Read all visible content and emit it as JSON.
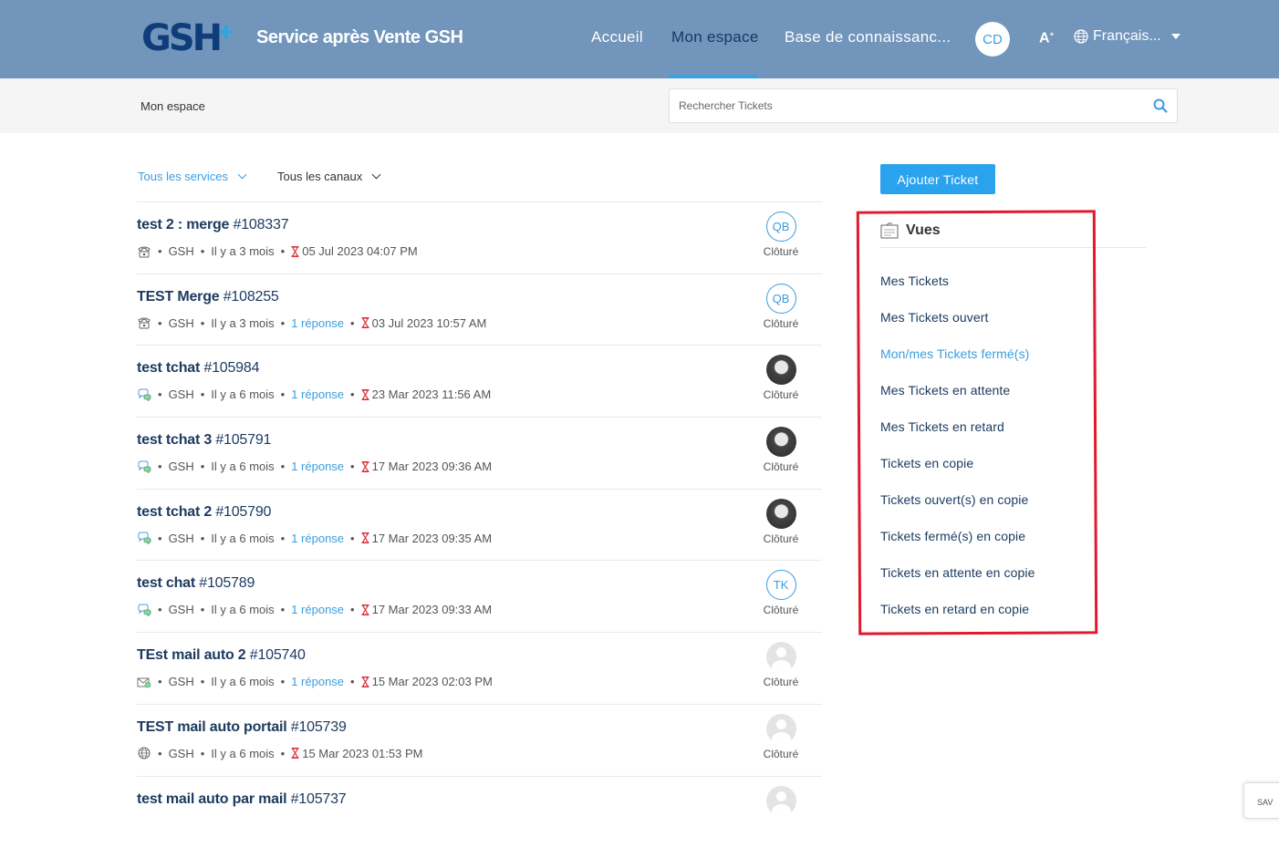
{
  "header": {
    "logo_text": "GSH",
    "logo_plus": "+",
    "title": "Service après Vente GSH",
    "nav": [
      {
        "label": "Accueil"
      },
      {
        "label": "Mon espace"
      },
      {
        "label": "Base de connaissanc..."
      }
    ],
    "avatar_initials": "CD",
    "font_size_glyph": "A",
    "language": "Français..."
  },
  "subbar": {
    "breadcrumb": "Mon espace",
    "search_placeholder": "Rechercher Tickets"
  },
  "filters": {
    "services": "Tous les services",
    "channels": "Tous les canaux"
  },
  "tickets": [
    {
      "title": "test 2 : merge",
      "number": "#108337",
      "channel": "phone-icon",
      "dept": "GSH",
      "age": "Il y a 3 mois",
      "replies": "",
      "due": "05 Jul 2023 04:07 PM",
      "assignee": "QB",
      "avatar": "initials",
      "status": "Clôturé"
    },
    {
      "title": "TEST Merge",
      "number": "#108255",
      "channel": "phone-icon",
      "dept": "GSH",
      "age": "Il y a 3 mois",
      "replies": "1 réponse",
      "due": "03 Jul 2023 10:57 AM",
      "assignee": "QB",
      "avatar": "initials",
      "status": "Clôturé"
    },
    {
      "title": "test tchat",
      "number": "#105984",
      "channel": "chat-icon",
      "dept": "GSH",
      "age": "Il y a 6 mois",
      "replies": "1 réponse",
      "due": "23 Mar 2023 11:56 AM",
      "assignee": "",
      "avatar": "photo",
      "status": "Clôturé"
    },
    {
      "title": "test tchat 3",
      "number": "#105791",
      "channel": "chat-icon",
      "dept": "GSH",
      "age": "Il y a 6 mois",
      "replies": "1 réponse",
      "due": "17 Mar 2023 09:36 AM",
      "assignee": "",
      "avatar": "photo",
      "status": "Clôturé"
    },
    {
      "title": "test tchat 2",
      "number": "#105790",
      "channel": "chat-icon",
      "dept": "GSH",
      "age": "Il y a 6 mois",
      "replies": "1 réponse",
      "due": "17 Mar 2023 09:35 AM",
      "assignee": "",
      "avatar": "photo",
      "status": "Clôturé"
    },
    {
      "title": "test chat",
      "number": "#105789",
      "channel": "chat-icon",
      "dept": "GSH",
      "age": "Il y a 6 mois",
      "replies": "1 réponse",
      "due": "17 Mar 2023 09:33 AM",
      "assignee": "TK",
      "avatar": "initials",
      "status": "Clôturé"
    },
    {
      "title": "TEst mail auto 2",
      "number": "#105740",
      "channel": "mail-icon",
      "dept": "GSH",
      "age": "Il y a 6 mois",
      "replies": "1 réponse",
      "due": "15 Mar 2023 02:03 PM",
      "assignee": "",
      "avatar": "blank",
      "status": "Clôturé"
    },
    {
      "title": "TEST mail auto portail",
      "number": "#105739",
      "channel": "web-icon",
      "dept": "GSH",
      "age": "Il y a 6 mois",
      "replies": "",
      "due": "15 Mar 2023 01:53 PM",
      "assignee": "",
      "avatar": "blank",
      "status": "Clôturé"
    },
    {
      "title": "test mail auto par mail",
      "number": "#105737",
      "channel": "mail-icon",
      "dept": "",
      "age": "",
      "replies": "",
      "due": "",
      "assignee": "",
      "avatar": "blank",
      "status": ""
    }
  ],
  "sidebar": {
    "add_button": "Ajouter Ticket",
    "views_title": "Vues",
    "views": [
      {
        "label": "Mes Tickets",
        "active": false
      },
      {
        "label": "Mes Tickets ouvert",
        "active": false
      },
      {
        "label": "Mon/mes Tickets fermé(s)",
        "active": true
      },
      {
        "label": "Mes Tickets en attente",
        "active": false
      },
      {
        "label": "Mes Tickets en retard",
        "active": false
      },
      {
        "label": "Tickets en copie",
        "active": false
      },
      {
        "label": "Tickets ouvert(s) en copie",
        "active": false
      },
      {
        "label": "Tickets fermé(s) en copie",
        "active": false
      },
      {
        "label": "Tickets en attente en copie",
        "active": false
      },
      {
        "label": "Tickets en retard en copie",
        "active": false
      }
    ]
  },
  "corner_widget": "SAV",
  "colors": {
    "header_bg": "#7295bb",
    "accent": "#3a9de0",
    "button": "#2aa3ef",
    "highlight": "#e0192e",
    "due_icon": "#d9303c"
  }
}
